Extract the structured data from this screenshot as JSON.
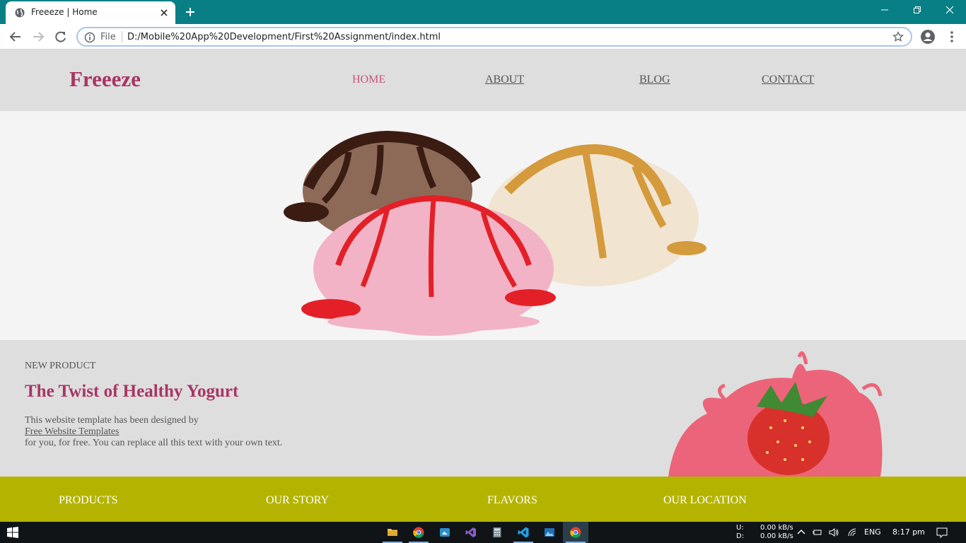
{
  "browser": {
    "tab_title": "Freeeze | Home",
    "omnibox_scheme": "File",
    "url": "D:/Mobile%20App%20Development/First%20Assignment/index.html"
  },
  "site": {
    "logo": "Freeeze",
    "nav": [
      {
        "label": "HOME",
        "active": true
      },
      {
        "label": "ABOUT",
        "active": false
      },
      {
        "label": "BLOG",
        "active": false
      },
      {
        "label": "CONTACT",
        "active": false
      }
    ],
    "promo": {
      "eyebrow": "NEW PRODUCT",
      "title": "The Twist of Healthy Yogurt",
      "body_line1": "This website template has been designed by",
      "link": "Free Website Templates",
      "body_line2": "for you, for free. You can replace all this text with your own text."
    },
    "footer": [
      "PRODUCTS",
      "OUR STORY",
      "FLAVORS",
      "OUR LOCATION"
    ]
  },
  "taskbar": {
    "net_labels": "U:\nD:",
    "net_speeds": "0.00 kB/s\n0.00 kB/s",
    "language": "ENG",
    "time": "8:17 pm"
  },
  "colors": {
    "chrome_frame": "#077f85",
    "brand": "#a83565",
    "footer": "#b4b400"
  },
  "icons": [
    "globe-icon",
    "close-icon",
    "plus-icon",
    "back-icon",
    "forward-icon",
    "reload-icon",
    "info-icon",
    "star-icon",
    "account-icon",
    "menu-icon"
  ]
}
